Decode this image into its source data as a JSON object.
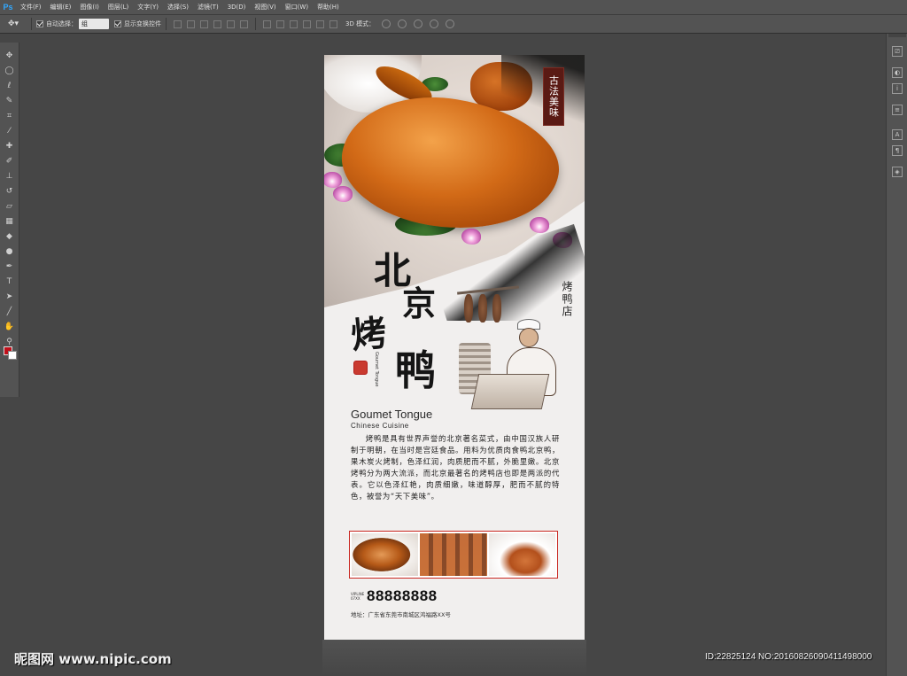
{
  "app": {
    "logo": "Ps"
  },
  "menu": [
    "文件(F)",
    "编辑(E)",
    "图像(I)",
    "图层(L)",
    "文字(Y)",
    "选择(S)",
    "滤镜(T)",
    "3D(D)",
    "视图(V)",
    "窗口(W)",
    "帮助(H)"
  ],
  "options": {
    "auto_select_label": "自动选择：",
    "auto_select_value": "组",
    "show_transform_label": "显示变换控件",
    "mode_3d_label": "3D 模式："
  },
  "colors": {
    "foreground": "#c0101b",
    "background": "#ffffff"
  },
  "toolbar_icons": [
    "move-tool-icon",
    "marquee-tool-icon",
    "lasso-tool-icon",
    "quick-select-tool-icon",
    "crop-tool-icon",
    "eyedropper-tool-icon",
    "healing-brush-tool-icon",
    "brush-tool-icon",
    "clone-stamp-tool-icon",
    "history-brush-tool-icon",
    "eraser-tool-icon",
    "gradient-tool-icon",
    "blur-tool-icon",
    "dodge-tool-icon",
    "pen-tool-icon",
    "type-tool-icon",
    "path-select-tool-icon",
    "shape-tool-icon",
    "hand-tool-icon",
    "zoom-tool-icon"
  ],
  "poster": {
    "seal_text": "古法美味",
    "title_chars": [
      "北",
      "京",
      "烤",
      "鸭"
    ],
    "shop_name": "烤鸭店",
    "en_title": "Goumet Tongue",
    "en_subtitle": "Chinese Cuisine",
    "intro": "烤鸭是具有世界声誉的北京著名菜式，由中国汉族人研制于明朝，在当时是宫廷食品。用料为优质肉食鸭北京鸭，果木炭火烤制，色泽红润，肉质肥而不腻，外脆里嫩。北京烤鸭分为两大流派，而北京最著名的烤鸭店也即是两派的代表。它以色泽红艳，肉质细嫩，味道醇厚，肥而不腻的特色，被誉为“天下美味”。",
    "phone_label": "VIPLINE 07XX",
    "phone": "88888888",
    "address": "地址：广东省东莞市南城区鸿福路XX号"
  },
  "watermarks": {
    "left": "昵图网 www.nipic.com",
    "right": "ID:22825124 NO:20160826090411498000"
  }
}
